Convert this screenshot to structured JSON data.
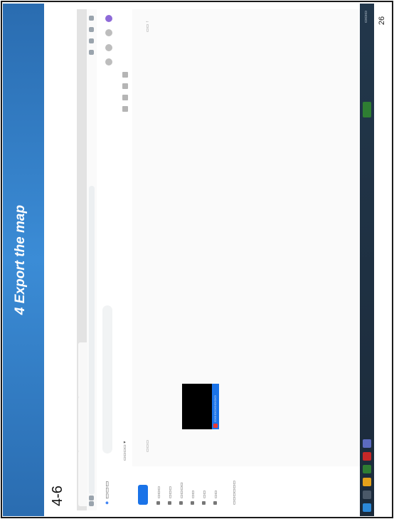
{
  "slide": {
    "title": "4 Export the map",
    "label": "4-6",
    "page_number": "26"
  },
  "browser": {
    "tabs": [
      "",
      "",
      ""
    ],
    "address": "",
    "app_search_placeholder": ""
  },
  "sidebar": {
    "items": [
      "",
      "",
      "",
      "",
      "",
      ""
    ]
  },
  "colors": {
    "banner": "#2f78c4",
    "primary_button": "#1a73e8",
    "taskbar": "#1b2a3a"
  }
}
